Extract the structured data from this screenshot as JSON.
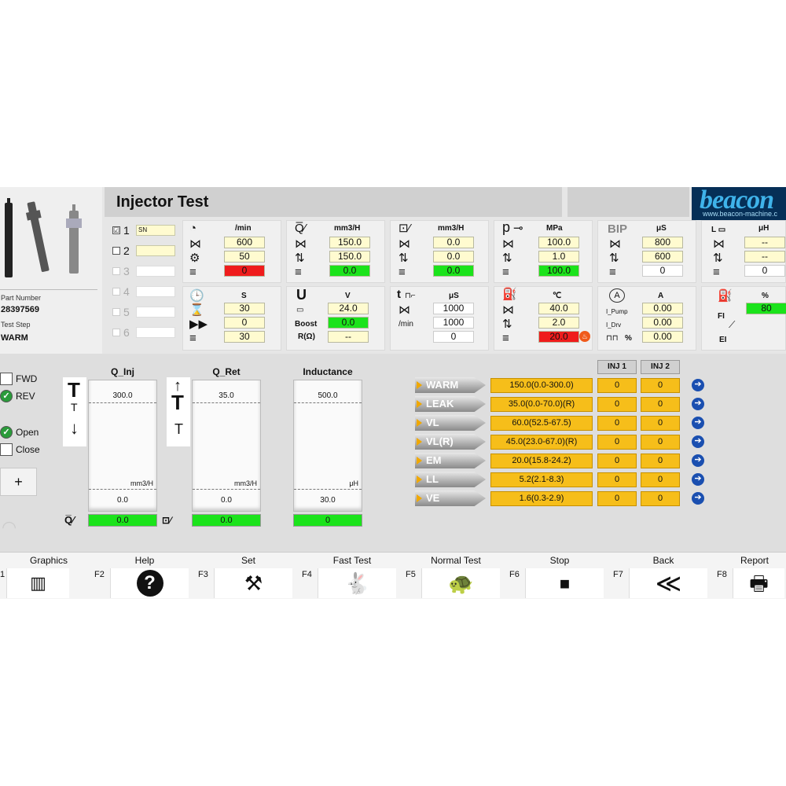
{
  "app": {
    "title": "Injector Test",
    "logo": {
      "name": "beacon",
      "url": "www.beacon-machine.c"
    }
  },
  "left": {
    "part_number_label": "Part Number",
    "part_number": "28397569",
    "test_step_label": "Test Step",
    "test_step": "WARM"
  },
  "steps": [
    {
      "num": "1",
      "checked": true,
      "tag": "SN"
    },
    {
      "num": "2",
      "checked": false,
      "tag": ""
    },
    {
      "num": "3",
      "checked": false,
      "tag": ""
    },
    {
      "num": "4",
      "checked": false,
      "tag": ""
    },
    {
      "num": "5",
      "checked": false,
      "tag": ""
    },
    {
      "num": "6",
      "checked": false,
      "tag": ""
    }
  ],
  "params": {
    "speed": {
      "unit": "/min",
      "values": [
        "600",
        "50",
        "0"
      ]
    },
    "flow": {
      "unit": "mm3/H",
      "values": [
        "150.0",
        "150.0",
        "0.0"
      ]
    },
    "return_flow": {
      "unit": "mm3/H",
      "values": [
        "0.0",
        "0.0",
        "0.0"
      ]
    },
    "pressure": {
      "p": "p",
      "unit": "MPa",
      "values": [
        "100.0",
        "1.0",
        "100.0"
      ]
    },
    "bip": {
      "label": "BIP",
      "unit": "μS",
      "values": [
        "800",
        "600",
        "0"
      ]
    },
    "inductance": {
      "unit": "μH",
      "values": [
        "--",
        "--",
        "0"
      ]
    },
    "time": {
      "unit": "S",
      "values": [
        "30",
        "0",
        "30"
      ]
    },
    "voltage": {
      "u": "U",
      "unit": "V",
      "values": [
        "24.0",
        "0.0",
        "--"
      ],
      "boost": "Boost",
      "r": "R(Ω)"
    },
    "pulse": {
      "t": "t",
      "unit": "μS",
      "min": "/min",
      "values": [
        "1000",
        "1000",
        "0"
      ]
    },
    "temperature": {
      "unit": "℃",
      "values": [
        "40.0",
        "2.0",
        "20.0"
      ]
    },
    "current": {
      "unit": "A",
      "values": [
        "0.00",
        "0.00",
        "0.00"
      ],
      "i_pump": "I_Pump",
      "i_drv": "I_Drv",
      "duty": "%"
    },
    "fuel": {
      "unit": "%",
      "value": "80",
      "fi": "FI",
      "ei": "EI"
    }
  },
  "controls": {
    "fwd": "FWD",
    "fwd_checked": false,
    "rev": "REV",
    "rev_checked": true,
    "open": "Open",
    "open_checked": true,
    "close": "Close",
    "close_checked": false,
    "plus": "+"
  },
  "gauges": [
    {
      "title": "Q_Inj",
      "max": "300.0",
      "min": "0.0",
      "unit": "mm3/H",
      "value": "0.0"
    },
    {
      "title": "Q_Ret",
      "max": "35.0",
      "min": "0.0",
      "unit": "mm3/H",
      "value": "0.0"
    },
    {
      "title": "Inductance",
      "max": "500.0",
      "min": "30.0",
      "unit": "μH",
      "value": "0"
    }
  ],
  "results": {
    "headers": [
      "INJ 1",
      "INJ 2"
    ],
    "rows": [
      {
        "name": "WARM",
        "range": "150.0(0.0-300.0)",
        "inj1": "0",
        "inj2": "0"
      },
      {
        "name": "LEAK",
        "range": "35.0(0.0-70.0)(R)",
        "inj1": "0",
        "inj2": "0"
      },
      {
        "name": "VL",
        "range": "60.0(52.5-67.5)",
        "inj1": "0",
        "inj2": "0"
      },
      {
        "name": "VL(R)",
        "range": "45.0(23.0-67.0)(R)",
        "inj1": "0",
        "inj2": "0"
      },
      {
        "name": "EM",
        "range": "20.0(15.8-24.2)",
        "inj1": "0",
        "inj2": "0"
      },
      {
        "name": "LL",
        "range": "5.2(2.1-8.3)",
        "inj1": "0",
        "inj2": "0"
      },
      {
        "name": "VE",
        "range": "1.6(0.3-2.9)",
        "inj1": "0",
        "inj2": "0"
      }
    ]
  },
  "fkeys": [
    {
      "caption": "Graphics",
      "fn": "1",
      "icon": "chart-icon",
      "glyph": "📊"
    },
    {
      "caption": "Help",
      "fn": "F2",
      "icon": "help-icon",
      "glyph": "?"
    },
    {
      "caption": "Set",
      "fn": "F3",
      "icon": "tools-icon",
      "glyph": "⚒"
    },
    {
      "caption": "Fast Test",
      "fn": "F4",
      "icon": "rabbit-icon",
      "glyph": "🐇"
    },
    {
      "caption": "Normal Test",
      "fn": "F5",
      "icon": "turtle-icon",
      "glyph": "🐢"
    },
    {
      "caption": "Stop",
      "fn": "F6",
      "icon": "stop-icon",
      "glyph": "⏹"
    },
    {
      "caption": "Back",
      "fn": "F7",
      "icon": "back-icon",
      "glyph": "≪"
    },
    {
      "caption": "Report",
      "fn": "F8",
      "icon": "printer-icon",
      "glyph": "🖶"
    }
  ],
  "colors": {
    "ok": "#1be31b",
    "alarm": "#ef1c1c",
    "result": "#f6be1a",
    "input": "#fffbd0"
  }
}
